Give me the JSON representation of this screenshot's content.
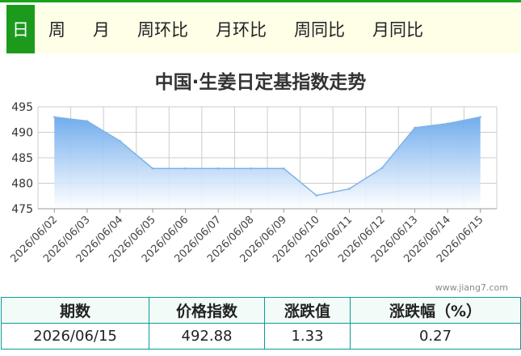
{
  "tabs": [
    {
      "label": "日",
      "active": true
    },
    {
      "label": "周",
      "active": false
    },
    {
      "label": "月",
      "active": false
    },
    {
      "label": "周环比",
      "active": false
    },
    {
      "label": "月环比",
      "active": false
    },
    {
      "label": "周同比",
      "active": false
    },
    {
      "label": "月同比",
      "active": false
    }
  ],
  "watermark": "www.jiang7.com",
  "chart_data": {
    "type": "area",
    "title": "中国·生姜日定基指数走势",
    "xlabel": "",
    "ylabel": "",
    "categories": [
      "2026/06/02",
      "2026/06/03",
      "2026/06/04",
      "2026/06/05",
      "2026/06/06",
      "2026/06/07",
      "2026/06/08",
      "2026/06/09",
      "2026/06/10",
      "2026/06/11",
      "2026/06/12",
      "2026/06/13",
      "2026/06/14",
      "2026/06/15"
    ],
    "values": [
      493.0,
      492.2,
      488.3,
      482.9,
      482.9,
      482.9,
      482.9,
      482.9,
      477.6,
      478.9,
      483.0,
      490.9,
      491.7,
      493.0
    ],
    "ylim": [
      475,
      495
    ],
    "yticks": [
      475,
      480,
      485,
      490,
      495
    ],
    "grid": true,
    "colors": {
      "line": "#7fb2e6",
      "fill_top": "#6aa8ec",
      "fill_bottom": "#ffffff",
      "grid": "#cccccc"
    }
  },
  "summary": {
    "headers": [
      "期数",
      "价格指数",
      "涨跌值",
      "涨跌幅（%）"
    ],
    "row": [
      "2026/06/15",
      "492.88",
      "1.33",
      "0.27"
    ]
  }
}
